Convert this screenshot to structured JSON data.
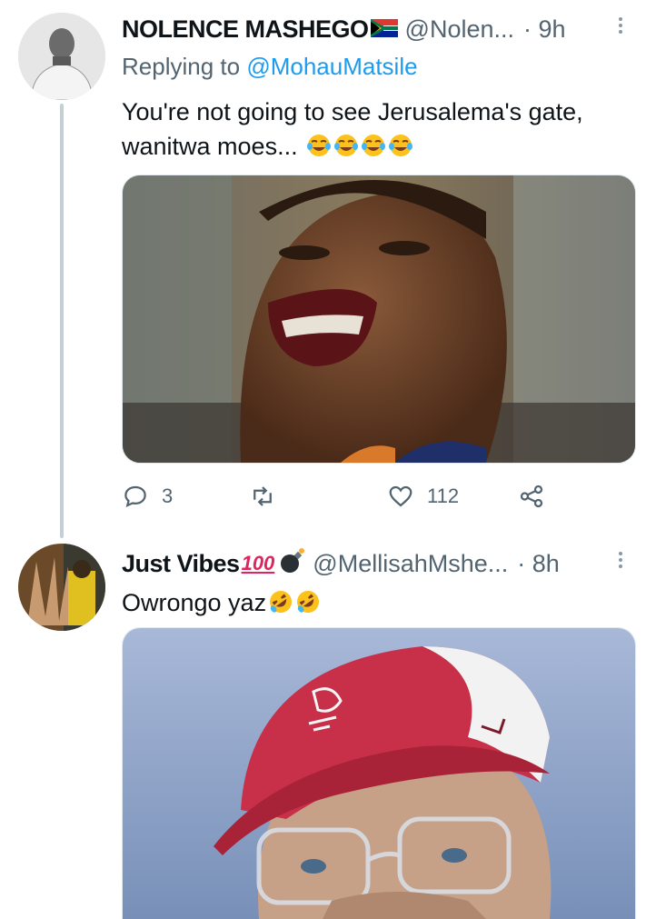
{
  "tweets": [
    {
      "display_name": "NOLENCE MASHEGO",
      "flag_icon": "south-africa-flag-icon",
      "handle": "@Nolen...",
      "time": "· 9h",
      "replying_prefix": "Replying to",
      "replying_to": "@MohauMatsile",
      "text_line1": "You're not going to see Jerusalema's gate,",
      "text_line2": "wanitwa moes...",
      "emojis": [
        "face-with-tears-of-joy-icon",
        "face-with-tears-of-joy-icon",
        "face-with-tears-of-joy-icon",
        "face-with-tears-of-joy-icon"
      ],
      "reply_count": "3",
      "retweet_count": "",
      "like_count": "112"
    },
    {
      "display_name": "Just Vibes",
      "badge_icons": [
        "hundred-points-icon",
        "bomb-icon"
      ],
      "handle": "@MellisahMshe...",
      "time": "· 8h",
      "text": "Owrongo yaz",
      "emojis": [
        "rolling-on-floor-laughing-icon",
        "rolling-on-floor-laughing-icon"
      ]
    }
  ],
  "colors": {
    "accent": "#1d9bf0",
    "secondary_text": "#536471",
    "thread_line": "#c4cfd6"
  }
}
